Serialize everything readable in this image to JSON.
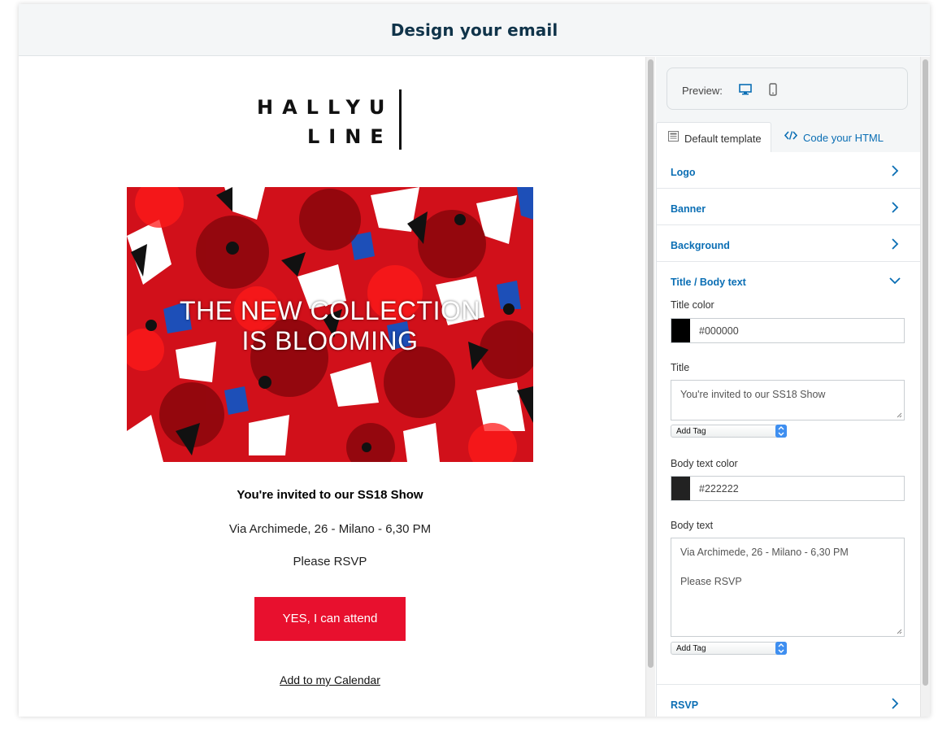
{
  "header": {
    "title": "Design your email"
  },
  "email": {
    "logo_line1": "HALLYU",
    "logo_line2": "LINE",
    "banner_line1": "THE NEW COLLECTION",
    "banner_line2": "IS BLOOMING",
    "title": "You're invited to our SS18 Show",
    "address": "Via Archimede, 26 - Milano - 6,30 PM",
    "rsvp": "Please RSVP",
    "attend_button": "YES, I can attend",
    "calendar_link": "Add to my Calendar"
  },
  "panel": {
    "preview_label": "Preview:",
    "tabs": {
      "default_template": "Default template",
      "code_html": "Code your HTML"
    },
    "sections": {
      "logo": "Logo",
      "banner": "Banner",
      "background": "Background",
      "title_body": "Title / Body text",
      "rsvp": "RSVP"
    },
    "title_color": {
      "label": "Title color",
      "value": "#000000",
      "swatch": "#000000"
    },
    "title_field": {
      "label": "Title",
      "value": "You're invited to our SS18 Show"
    },
    "body_color": {
      "label": "Body text color",
      "value": "#222222",
      "swatch": "#222222"
    },
    "body_field": {
      "label": "Body text",
      "line1": "Via Archimede, 26 - Milano - 6,30 PM",
      "line2": "Please RSVP"
    },
    "add_tag": "Add Tag"
  },
  "colors": {
    "accent_blue": "#0a6eb4",
    "button_red": "#e8102e",
    "header_text": "#10344a"
  }
}
